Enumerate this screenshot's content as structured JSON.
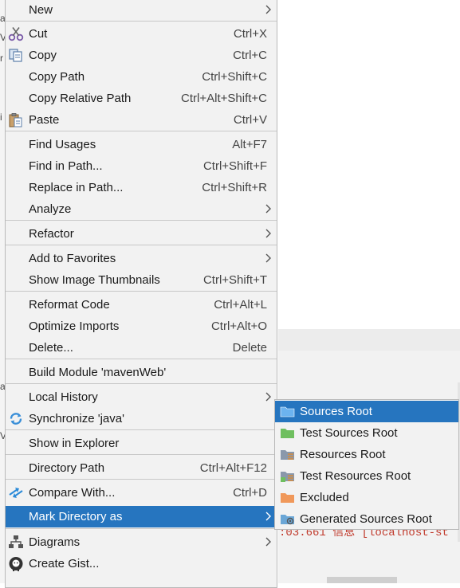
{
  "background": {
    "console_text": ":03.661 信息 [localhost-st",
    "left_edge_chars": [
      "a",
      "V",
      "r",
      "i",
      "a",
      "V"
    ]
  },
  "context_menu": {
    "items": [
      {
        "label": "New",
        "shortcut": "",
        "submenu": true,
        "icon": null
      },
      {
        "label": "Cut",
        "shortcut": "Ctrl+X",
        "submenu": false,
        "icon": "scissors-icon"
      },
      {
        "label": "Copy",
        "shortcut": "Ctrl+C",
        "submenu": false,
        "icon": "copy-icon"
      },
      {
        "label": "Copy Path",
        "shortcut": "Ctrl+Shift+C",
        "submenu": false,
        "icon": null
      },
      {
        "label": "Copy Relative Path",
        "shortcut": "Ctrl+Alt+Shift+C",
        "submenu": false,
        "icon": null
      },
      {
        "label": "Paste",
        "shortcut": "Ctrl+V",
        "submenu": false,
        "icon": "paste-icon"
      },
      {
        "label": "Find Usages",
        "shortcut": "Alt+F7",
        "submenu": false,
        "icon": null
      },
      {
        "label": "Find in Path...",
        "shortcut": "Ctrl+Shift+F",
        "submenu": false,
        "icon": null
      },
      {
        "label": "Replace in Path...",
        "shortcut": "Ctrl+Shift+R",
        "submenu": false,
        "icon": null
      },
      {
        "label": "Analyze",
        "shortcut": "",
        "submenu": true,
        "icon": null
      },
      {
        "label": "Refactor",
        "shortcut": "",
        "submenu": true,
        "icon": null
      },
      {
        "label": "Add to Favorites",
        "shortcut": "",
        "submenu": true,
        "icon": null
      },
      {
        "label": "Show Image Thumbnails",
        "shortcut": "Ctrl+Shift+T",
        "submenu": false,
        "icon": null
      },
      {
        "label": "Reformat Code",
        "shortcut": "Ctrl+Alt+L",
        "submenu": false,
        "icon": null
      },
      {
        "label": "Optimize Imports",
        "shortcut": "Ctrl+Alt+O",
        "submenu": false,
        "icon": null
      },
      {
        "label": "Delete...",
        "shortcut": "Delete",
        "submenu": false,
        "icon": null
      },
      {
        "label": "Build Module 'mavenWeb'",
        "shortcut": "",
        "submenu": false,
        "icon": null
      },
      {
        "label": "Local History",
        "shortcut": "",
        "submenu": true,
        "icon": null
      },
      {
        "label": "Synchronize 'java'",
        "shortcut": "",
        "submenu": false,
        "icon": "sync-icon"
      },
      {
        "label": "Show in Explorer",
        "shortcut": "",
        "submenu": false,
        "icon": null
      },
      {
        "label": "Directory Path",
        "shortcut": "Ctrl+Alt+F12",
        "submenu": false,
        "icon": null
      },
      {
        "label": "Compare With...",
        "shortcut": "Ctrl+D",
        "submenu": false,
        "icon": "compare-icon"
      },
      {
        "label": "Mark Directory as",
        "shortcut": "",
        "submenu": true,
        "icon": null,
        "active": true
      },
      {
        "label": "Diagrams",
        "shortcut": "",
        "submenu": true,
        "icon": "diagram-icon"
      },
      {
        "label": "Create Gist...",
        "shortcut": "",
        "submenu": false,
        "icon": "github-icon"
      }
    ]
  },
  "mark_directory_submenu": {
    "items": [
      {
        "label": "Sources Root",
        "icon": "sources-root-folder-icon",
        "color": "#3b8fd6",
        "active": true
      },
      {
        "label": "Test Sources Root",
        "icon": "test-sources-root-folder-icon",
        "color": "#6fbf5f"
      },
      {
        "label": "Resources Root",
        "icon": "resources-root-folder-icon",
        "color": "#8a98ab"
      },
      {
        "label": "Test Resources Root",
        "icon": "test-resources-root-folder-icon",
        "color": "#8a98ab"
      },
      {
        "label": "Excluded",
        "icon": "excluded-folder-icon",
        "color": "#f0985a"
      },
      {
        "label": "Generated Sources Root",
        "icon": "generated-sources-root-folder-icon",
        "color": "#6aa6d6"
      }
    ]
  },
  "colors": {
    "menu_background": "#f2f2f2",
    "selection": "#2675bf",
    "separator": "#c8c8c8"
  }
}
